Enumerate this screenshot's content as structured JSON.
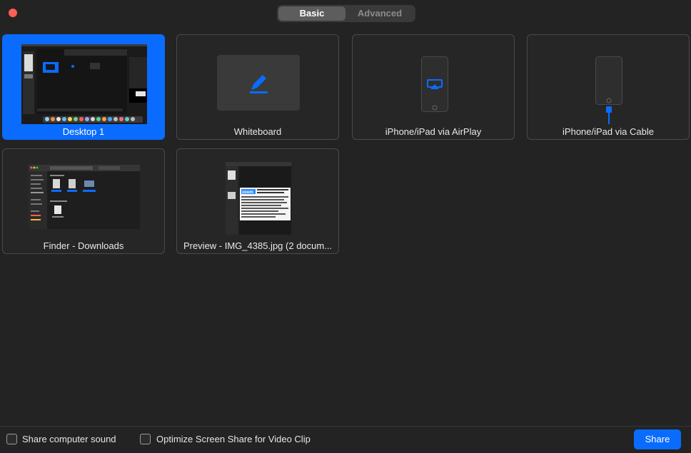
{
  "tabs": [
    {
      "label": "Basic",
      "active": true
    },
    {
      "label": "Advanced",
      "active": false
    }
  ],
  "tiles": [
    {
      "label": "Desktop 1",
      "selected": true,
      "icon": "desktop-thumbnail"
    },
    {
      "label": "Whiteboard",
      "icon": "pencil-icon"
    },
    {
      "label": "iPhone/iPad via AirPlay",
      "icon": "airplay-icon"
    },
    {
      "label": "iPhone/iPad via Cable",
      "icon": "cable-icon"
    },
    {
      "label": "Finder - Downloads",
      "icon": "finder-thumbnail"
    },
    {
      "label": "Preview - IMG_4385.jpg (2 docum...",
      "icon": "preview-thumbnail"
    }
  ],
  "preview_logo": "zoom",
  "options": {
    "share_sound": {
      "label": "Share computer sound",
      "checked": false
    },
    "optimize_video": {
      "label": "Optimize Screen Share for Video Clip",
      "checked": false
    }
  },
  "share_button": "Share",
  "colors": {
    "accent": "#0a6cff",
    "close": "#ff5f57",
    "background": "#232323"
  }
}
